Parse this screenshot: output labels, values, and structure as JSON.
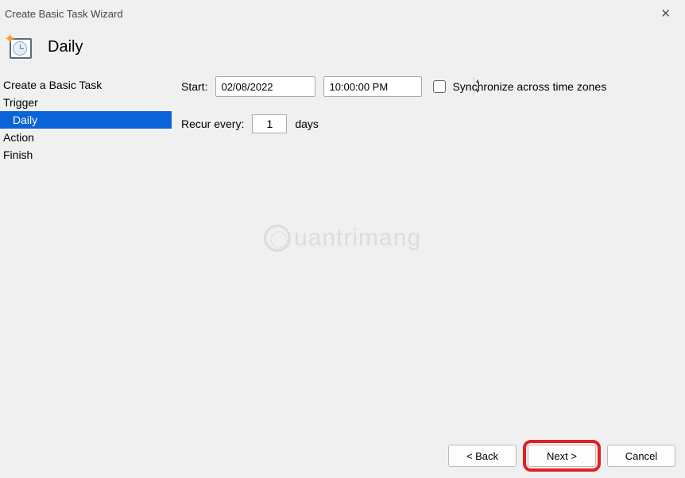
{
  "window": {
    "title": "Create Basic Task Wizard"
  },
  "header": {
    "heading": "Daily"
  },
  "sidebar": {
    "items": [
      {
        "label": "Create a Basic Task",
        "selected": false,
        "sub": false
      },
      {
        "label": "Trigger",
        "selected": false,
        "sub": false
      },
      {
        "label": "Daily",
        "selected": true,
        "sub": true
      },
      {
        "label": "Action",
        "selected": false,
        "sub": false
      },
      {
        "label": "Finish",
        "selected": false,
        "sub": false
      }
    ]
  },
  "form": {
    "start_label": "Start:",
    "date_value": "02/08/2022",
    "time_value": "10:00:00 PM",
    "sync_label": "Synchronize across time zones",
    "recur_label": "Recur every:",
    "recur_value": "1",
    "recur_unit": "days"
  },
  "footer": {
    "back_label": "< Back",
    "next_label": "Next >",
    "cancel_label": "Cancel"
  },
  "watermark": {
    "text": "uantrimang"
  }
}
